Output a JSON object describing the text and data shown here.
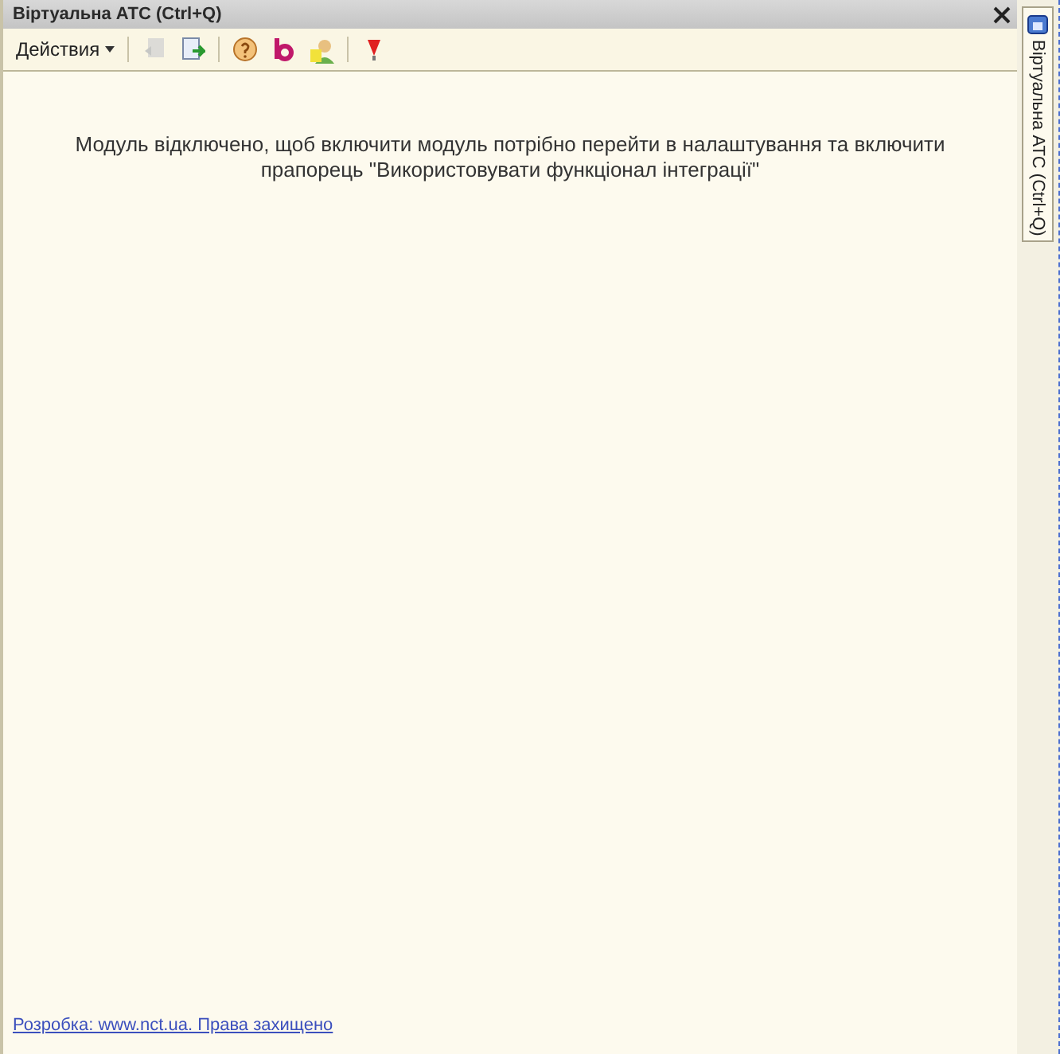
{
  "window": {
    "title": "Віртуальна АТС (Ctrl+Q)"
  },
  "toolbar": {
    "actions_menu": "Действия",
    "buttons": [
      {
        "kind": "back",
        "disabled": true
      },
      {
        "kind": "export",
        "disabled": false
      },
      {
        "kind": "sep"
      },
      {
        "kind": "help",
        "disabled": false
      },
      {
        "kind": "brand",
        "disabled": false
      },
      {
        "kind": "user",
        "disabled": false
      },
      {
        "kind": "sep"
      },
      {
        "kind": "marker",
        "disabled": false
      }
    ]
  },
  "message": "Модуль відключено, щоб включити модуль потрібно перейти в налаштування та включити прапорець \"Використовувати функціонал інтеграції\"",
  "footer_link": "Розробка: www.nct.ua. Права захищено",
  "side_tab": {
    "label": "Віртуальна АТС (Ctrl+Q)"
  }
}
